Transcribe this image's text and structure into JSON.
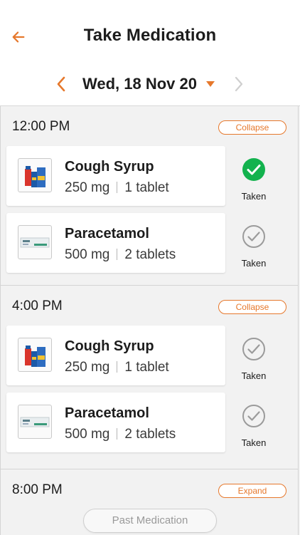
{
  "header": {
    "title": "Take Medication"
  },
  "date_nav": {
    "label": "Wed, 18 Nov 20"
  },
  "groups": [
    {
      "time": "12:00 PM",
      "toggle_label": "Collapse",
      "meds": [
        {
          "name": "Cough Syrup",
          "dose": "250 mg",
          "qty": "1 tablet",
          "status_label": "Taken",
          "taken": true
        },
        {
          "name": "Paracetamol",
          "dose": "500 mg",
          "qty": "2 tablets",
          "status_label": "Taken",
          "taken": false
        }
      ]
    },
    {
      "time": "4:00 PM",
      "toggle_label": "Collapse",
      "meds": [
        {
          "name": "Cough Syrup",
          "dose": "250 mg",
          "qty": "1 tablet",
          "status_label": "Taken",
          "taken": false
        },
        {
          "name": "Paracetamol",
          "dose": "500 mg",
          "qty": "2 tablets",
          "status_label": "Taken",
          "taken": false
        }
      ]
    },
    {
      "time": "8:00 PM",
      "toggle_label": "Expand",
      "meds": []
    }
  ],
  "past_button": {
    "label": "Past Medication"
  },
  "colors": {
    "accent": "#e6782c",
    "taken_green": "#13b24e",
    "untaken_gray": "#9b9b9b"
  },
  "icons": {
    "back": "arrow-left-icon",
    "prev": "chevron-left-icon",
    "next": "chevron-right-icon",
    "caret": "caret-down-icon",
    "check": "check-circle-icon"
  }
}
